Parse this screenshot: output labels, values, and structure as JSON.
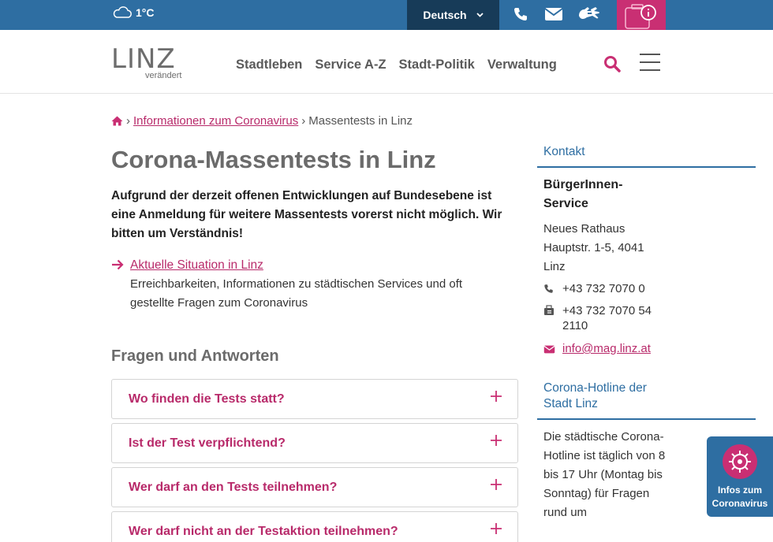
{
  "topbar": {
    "temperature": "1°C",
    "language": "Deutsch"
  },
  "header": {
    "logo_word": "LINZ",
    "logo_sub": "verändert",
    "nav": [
      "Stadtleben",
      "Service A-Z",
      "Stadt-Politik",
      "Verwaltung"
    ]
  },
  "breadcrumb": {
    "link": "Informationen zum Coronavirus",
    "current": "Massentests in Linz"
  },
  "main": {
    "title": "Corona-Massentests in Linz",
    "intro": "Aufgrund der derzeit offenen Entwicklungen auf Bundesebene ist eine Anmeldung für weitere Massentests vorerst nicht möglich. Wir bitten um Verständnis!",
    "link_label": "Aktuelle Situation in Linz",
    "link_desc": "Erreichbarkeiten, Informationen zu städtischen Services und oft gestellte Fragen zum Coronavirus",
    "faq_heading": "Fragen und Antworten",
    "faq": [
      "Wo finden die Tests statt?",
      "Ist der Test verpflichtend?",
      "Wer darf an den Tests teilnehmen?",
      "Wer darf nicht an der Testaktion teilnehmen?"
    ]
  },
  "sidebar": {
    "contact_title": "Kontakt",
    "service_name": "BürgerInnen-Service",
    "address": "Neues Rathaus Hauptstr. 1-5, 4041 Linz",
    "phone": "+43 732 7070 0",
    "fax": "+43 732 7070 54 2110",
    "email": "info@mag.linz.at",
    "hotline_title": "Corona-Hotline der Stadt Linz",
    "hotline_text": "Die städtische Corona-Hotline ist täglich von 8 bis 17 Uhr (Montag bis Sonntag) für Fragen rund um"
  },
  "float": {
    "label": "Infos zum Coronavirus"
  },
  "colors": {
    "primary_blue": "#2e6ea2",
    "dark_blue": "#173b58",
    "accent_pink": "#b82a6a",
    "heading_gray": "#6b6b6b"
  }
}
